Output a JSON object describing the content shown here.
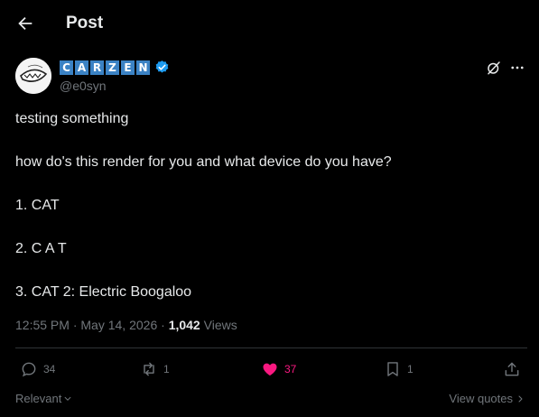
{
  "header": {
    "title": "Post",
    "back_icon": "arrow-left-icon"
  },
  "author": {
    "name_letters": [
      "C",
      "A",
      "R",
      "Z",
      "E",
      "N"
    ],
    "handle": "@e0syn",
    "verified": true,
    "accent": "#1d9bf0"
  },
  "tweet": {
    "lines": [
      "testing something",
      "how do's this render for you and what device do you have?",
      "1. CAT",
      "2. C A T",
      "3. CAT 2: Electric Boogaloo"
    ]
  },
  "meta": {
    "time": "12:55 PM",
    "separator": "·",
    "date": "May 14, 2026",
    "views_count": "1,042",
    "views_label": "Views"
  },
  "actions": {
    "replies": "34",
    "reposts": "1",
    "likes": "37",
    "bookmarks": "1",
    "like_color": "#f91880"
  },
  "footer": {
    "relevant_label": "Relevant",
    "view_quotes_label": "View quotes"
  }
}
